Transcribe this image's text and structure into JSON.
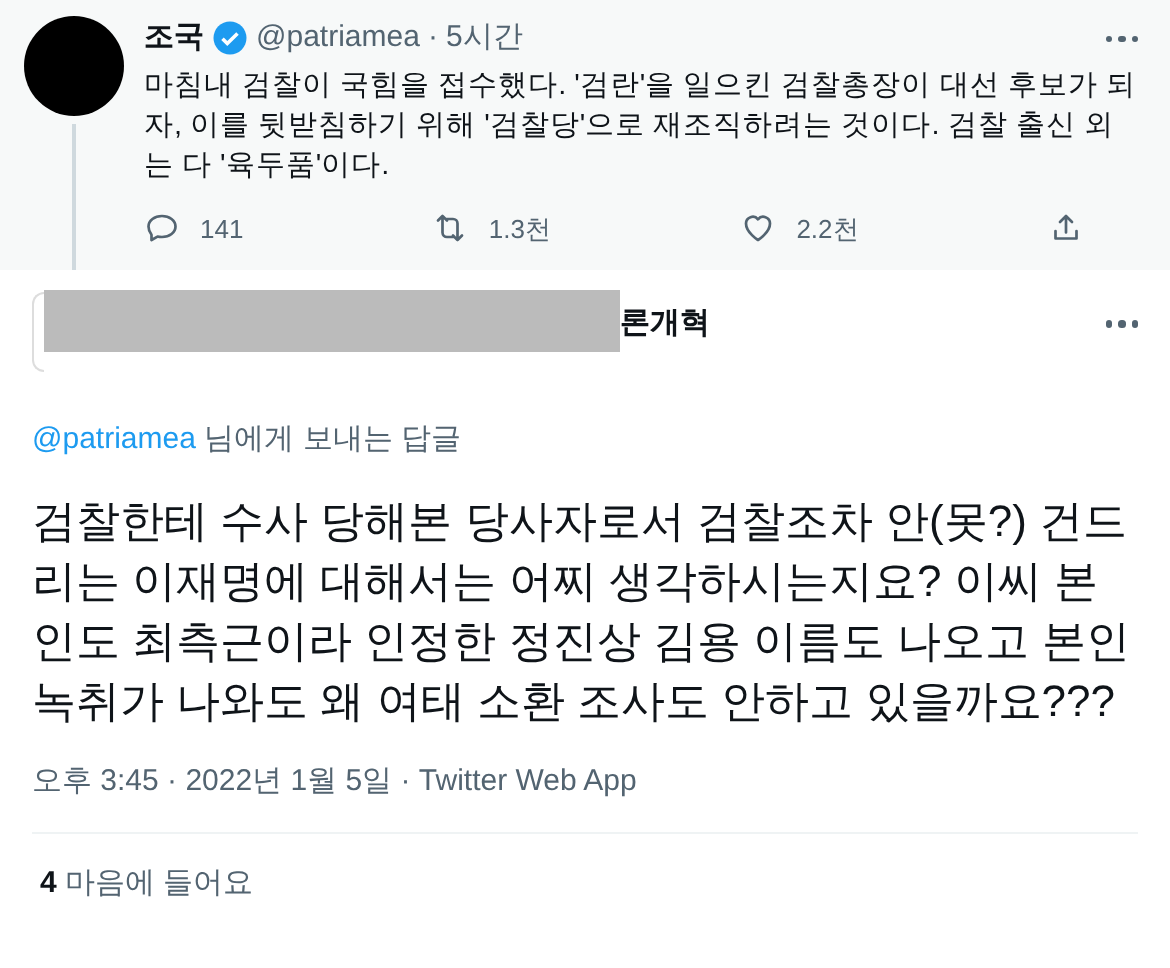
{
  "parent_tweet": {
    "name": "조국",
    "verified": true,
    "handle": "@patriamea",
    "separator": "·",
    "time": "5시간",
    "text": "마침내 검찰이 국힘을 접수했다. '검란'을 일으킨 검찰총장이 대선 후보가 되자, 이를 뒷받침하기 위해 '검찰당'으로 재조직하려는 것이다. 검찰 출신 외는 다 '육두품'이다.",
    "replies": "141",
    "retweets": "1.3천",
    "likes": "2.2천"
  },
  "reply_tweet": {
    "name_visible": "론개혁",
    "reply_to_handle": "@patriamea",
    "reply_to_suffix": "님에게 보내는 답글",
    "text": "검찰한테 수사 당해본 당사자로서 검찰조차 안(못?) 건드리는 이재명에 대해서는 어찌 생각하시는지요? 이씨 본인도 최측근이라 인정한 정진상 김용 이름도 나오고 본인 녹취가 나와도 왜 여태 소환 조사도 안하고 있을까요???",
    "timestamp": "오후 3:45 · 2022년 1월 5일 · Twitter Web App",
    "like_count": "4",
    "like_label": "마음에 들어요"
  }
}
